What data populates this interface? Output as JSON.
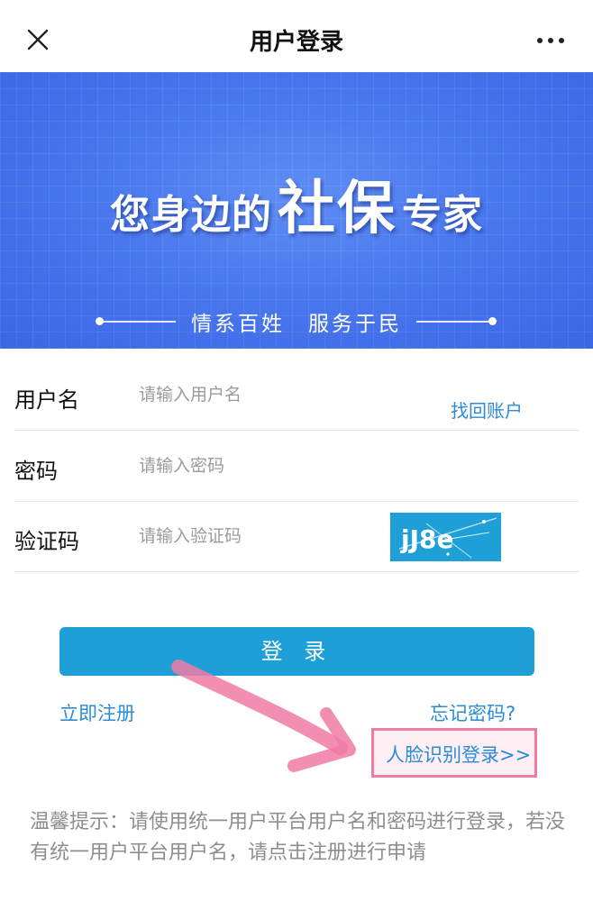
{
  "header": {
    "title": "用户登录",
    "close_icon": "close-icon",
    "more_icon": "more-dots-icon"
  },
  "banner": {
    "headline_left": "您身边的",
    "headline_main": "社保",
    "headline_right": "专家",
    "subtitle": "情系百姓　服务于民",
    "background_color": "#4a78ee"
  },
  "form": {
    "username": {
      "label": "用户名",
      "placeholder": "请输入用户名",
      "value": ""
    },
    "recover_account": "找回账户",
    "password": {
      "label": "密码",
      "placeholder": "请输入密码",
      "value": ""
    },
    "captcha": {
      "label": "验证码",
      "placeholder": "请输入验证码",
      "value": "",
      "image_text": "jJ8e"
    }
  },
  "actions": {
    "login_label": "登 录",
    "register_label": "立即注册",
    "forgot_label": "忘记密码?",
    "face_login_label": "人脸识别登录>>"
  },
  "tip": {
    "text": "温馨提示：请使用统一用户平台用户名和密码进行登录，若没有统一用户平台用户名，请点击注册进行申请"
  },
  "colors": {
    "accent": "#1e9fd8",
    "link": "#2b8bd6",
    "annotation": "#f07aa4"
  }
}
